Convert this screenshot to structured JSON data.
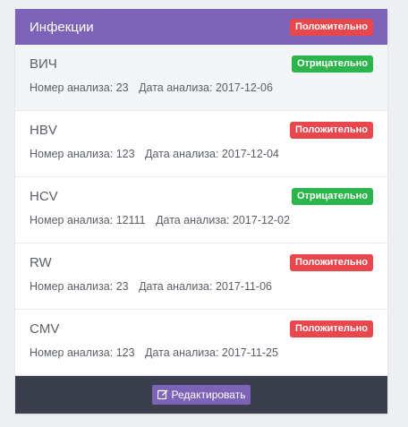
{
  "panel": {
    "title": "Инфекции",
    "status_badge": "Положительно"
  },
  "meta_labels": {
    "number": "Номер анализа:",
    "date": "Дата анализа:"
  },
  "items": [
    {
      "name": "ВИЧ",
      "status": "Отрицательно",
      "number": "23",
      "date": "2017-12-06"
    },
    {
      "name": "HBV",
      "status": "Положительно",
      "number": "123",
      "date": "2017-12-04"
    },
    {
      "name": "HCV",
      "status": "Отрицательно",
      "number": "12111",
      "date": "2017-12-02"
    },
    {
      "name": "RW",
      "status": "Положительно",
      "number": "23",
      "date": "2017-11-06"
    },
    {
      "name": "CMV",
      "status": "Положительно",
      "number": "123",
      "date": "2017-11-25"
    }
  ],
  "footer": {
    "edit_label": "Редактировать",
    "edit_icon": "edit-icon"
  },
  "colors": {
    "accent": "#7d63b8",
    "positive": "#e8474d",
    "negative": "#2bb54a",
    "footer_bg": "#3a3e4d"
  }
}
